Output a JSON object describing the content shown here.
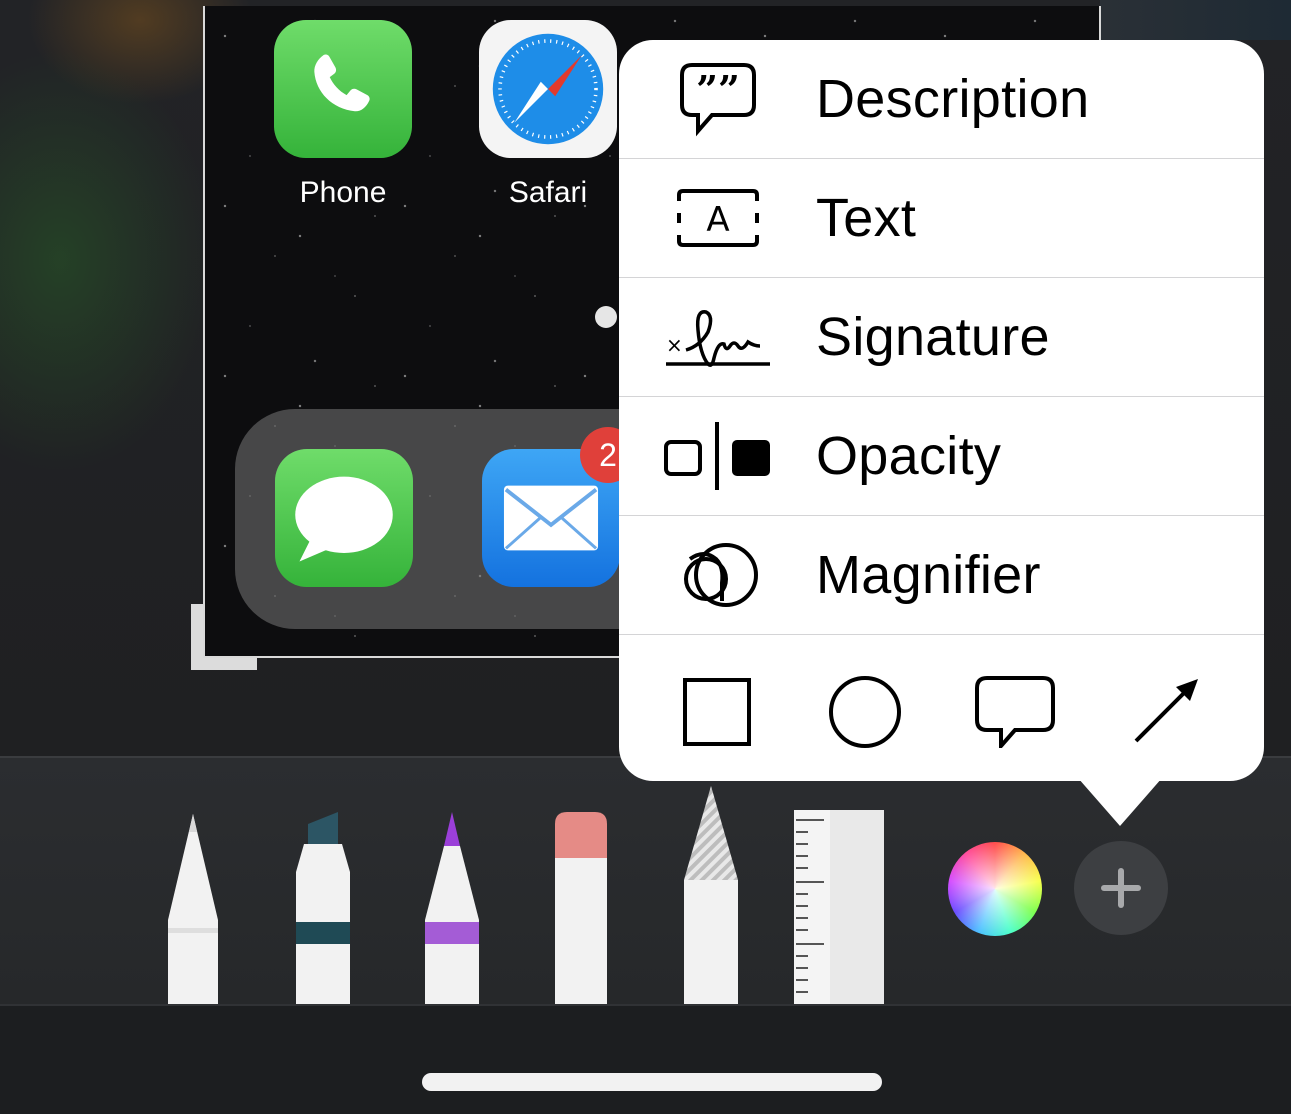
{
  "home_screen": {
    "apps": [
      {
        "label": "Phone",
        "icon": "phone-icon"
      },
      {
        "label": "Safari",
        "icon": "safari-compass-icon"
      }
    ],
    "dock": [
      {
        "icon": "messages-bubble-icon"
      },
      {
        "icon": "mail-envelope-icon",
        "badge": "2"
      }
    ]
  },
  "markup_menu": {
    "items": [
      {
        "label": "Description",
        "icon": "quote-bubble-icon"
      },
      {
        "label": "Text",
        "icon": "text-box-icon"
      },
      {
        "label": "Signature",
        "icon": "signature-icon"
      },
      {
        "label": "Opacity",
        "icon": "opacity-icon"
      },
      {
        "label": "Magnifier",
        "icon": "magnifier-icon"
      }
    ],
    "shapes": [
      "square-shape-icon",
      "circle-shape-icon",
      "speech-bubble-shape-icon",
      "arrow-shape-icon"
    ]
  },
  "toolbar": {
    "tools": [
      "pen",
      "marker",
      "pencil",
      "eraser",
      "lasso",
      "ruler"
    ],
    "colors": {
      "marker_band": "#1f4a55",
      "pencil_band": "#a45cd6",
      "pencil_tip": "#9b3fd9",
      "eraser_cap": "#e58b86"
    }
  }
}
